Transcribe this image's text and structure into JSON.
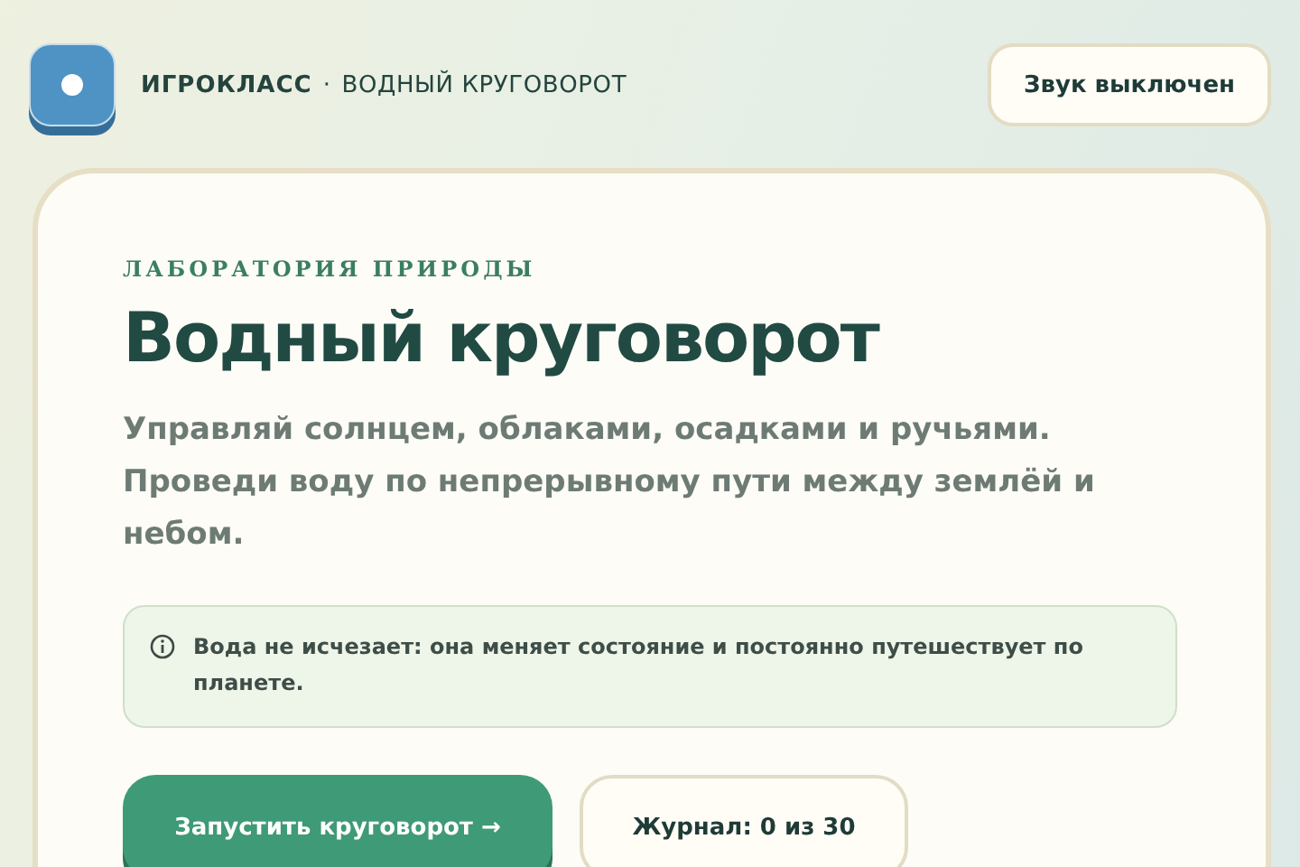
{
  "header": {
    "brand": "ИГРОКЛАСС",
    "separator": "·",
    "subtitle": "ВОДНЫЙ КРУГОВОРОТ",
    "sound_button": "Звук выключен"
  },
  "card": {
    "eyebrow": "ЛАБОРАТОРИЯ ПРИРОДЫ",
    "title": "Водный круговорот",
    "lead": "Управляй солнцем, облаками, осадками и ручьями. Проведи воду по непрерывному пути между землёй и небом.",
    "info": "Вода не исчезает: она меняет состояние и постоянно путешествует по планете.",
    "buttons": [
      {
        "label": "Запустить круговорот →",
        "kind": "primary"
      },
      {
        "label": "Журнал: 0 из 30",
        "kind": "secondary"
      }
    ]
  }
}
